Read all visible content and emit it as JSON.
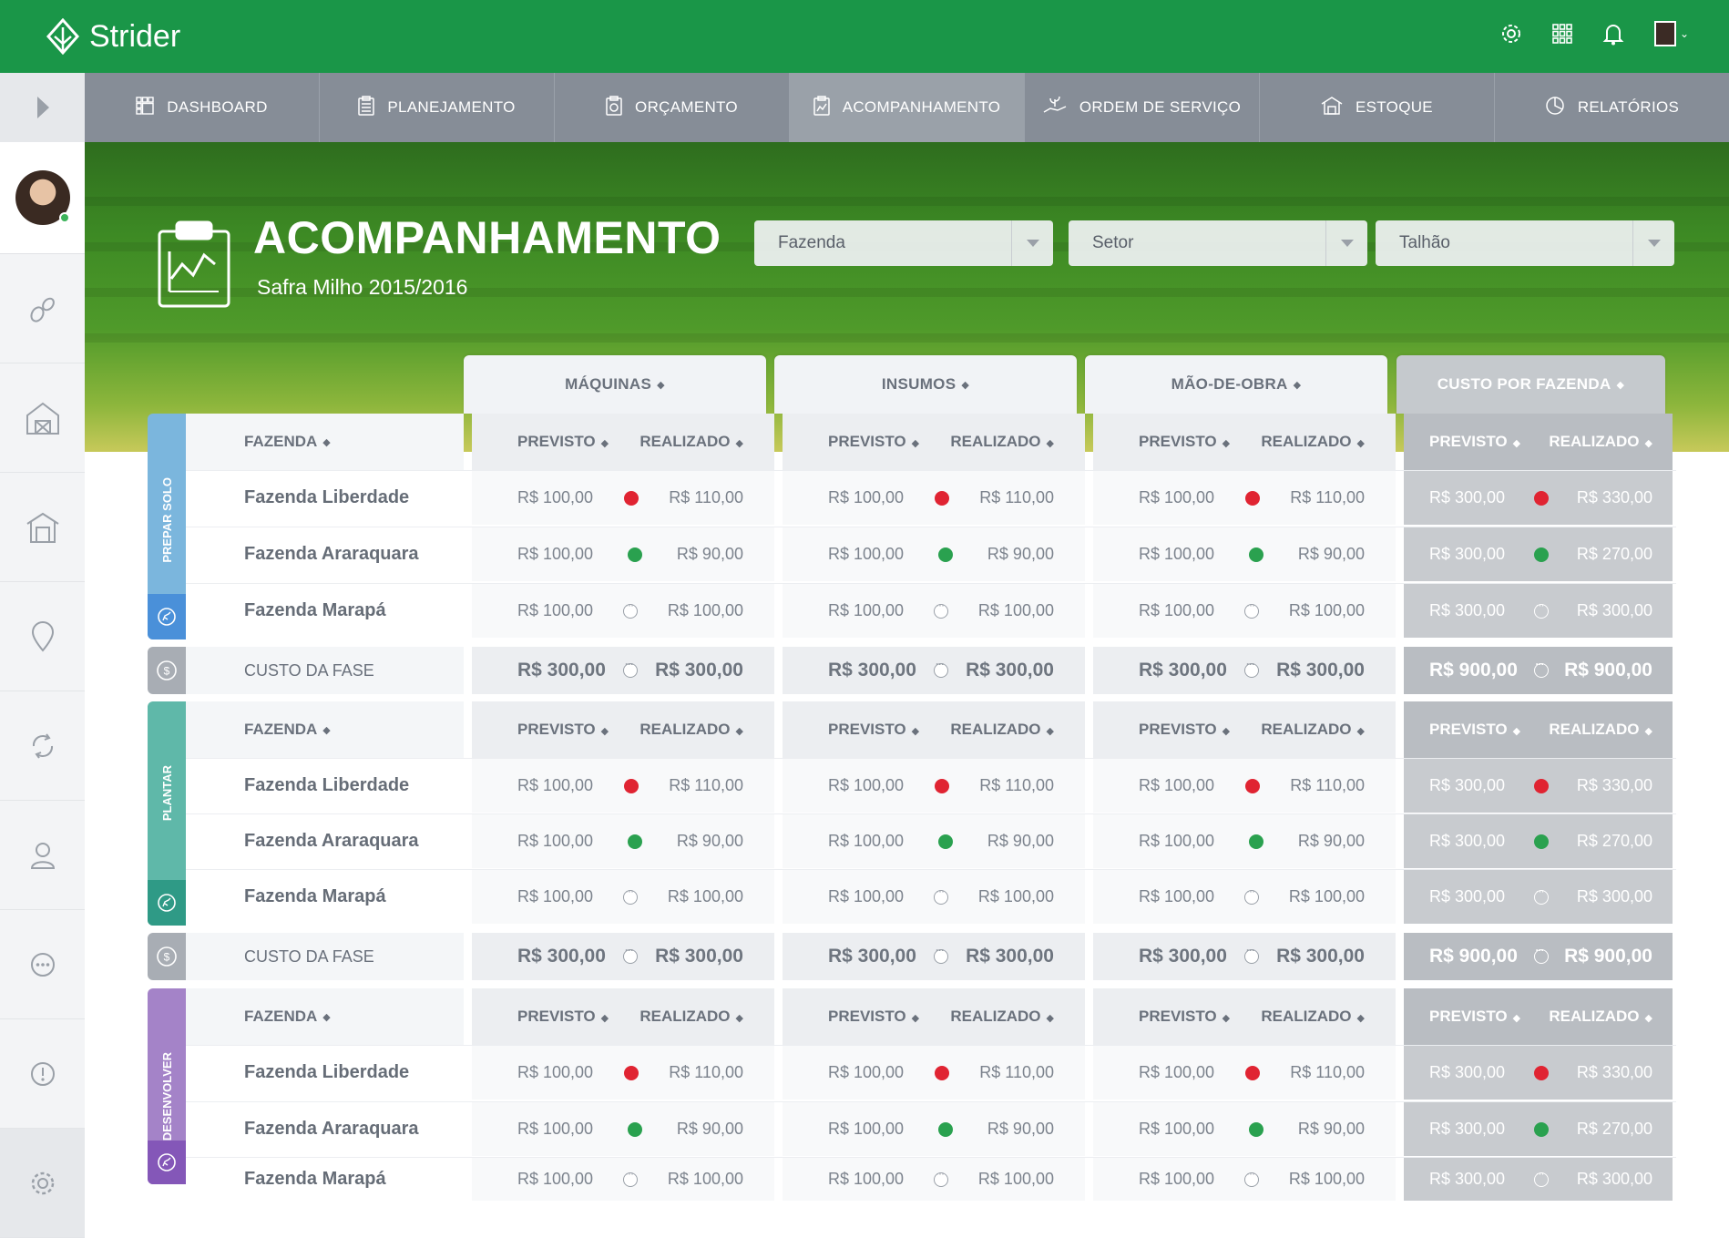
{
  "app": {
    "name": "Strider"
  },
  "nav": [
    {
      "label": "DASHBOARD",
      "icon": "dashboard-icon"
    },
    {
      "label": "PLANEJAMENTO",
      "icon": "clipboard-list-icon"
    },
    {
      "label": "ORÇAMENTO",
      "icon": "clipboard-money-icon"
    },
    {
      "label": "ACOMPANHAMENTO",
      "icon": "clipboard-chart-icon",
      "active": true
    },
    {
      "label": "ORDEM DE SERVIÇO",
      "icon": "hand-plant-icon"
    },
    {
      "label": "ESTOQUE",
      "icon": "warehouse-icon"
    },
    {
      "label": "RELATÓRIOS",
      "icon": "pie-chart-icon"
    }
  ],
  "page": {
    "title": "ACOMPANHAMENTO",
    "subtitle": "Safra Milho 2015/2016"
  },
  "filters": {
    "fazenda": "Fazenda",
    "setor": "Setor",
    "talhao": "Talhão"
  },
  "columns": {
    "maquinas": "MÁQUINAS",
    "insumos": "INSUMOS",
    "mao_de_obra": "MÃO-DE-OBRA",
    "custo_fazenda": "CUSTO POR FAZENDA"
  },
  "headers": {
    "fazenda": "FAZENDA",
    "previsto": "PREVISTO",
    "realizado": "REALIZADO",
    "custo_fase": "CUSTO DA FASE"
  },
  "phases": [
    {
      "name": "PREPAR SOLO",
      "color": "#7bb6dd",
      "icon_color": "#4a90d9"
    },
    {
      "name": "PLANTAR",
      "color": "#5fb8a9",
      "icon_color": "#2f9a86"
    },
    {
      "name": "DESENVOLVER",
      "color": "#a483c8",
      "icon_color": "#8457b8"
    }
  ],
  "farms": [
    {
      "name": "Fazenda Liberdade",
      "status": "red",
      "prev": "R$ 100,00",
      "real": "R$ 110,00",
      "tprev": "R$ 300,00",
      "treal": "R$ 330,00"
    },
    {
      "name": "Fazenda Araraquara",
      "status": "green",
      "prev": "R$ 100,00",
      "real": "R$ 90,00",
      "tprev": "R$ 300,00",
      "treal": "R$ 270,00"
    },
    {
      "name": "Fazenda Marapá",
      "status": "neutral",
      "prev": "R$ 100,00",
      "real": "R$ 100,00",
      "tprev": "R$ 300,00",
      "treal": "R$ 300,00"
    }
  ],
  "custo": {
    "prev": "R$ 300,00",
    "real": "R$ 300,00",
    "tprev": "R$ 900,00",
    "treal": "R$ 900,00"
  },
  "sidebar_icons": [
    "seeds-icon",
    "barn-icon",
    "warehouse-icon",
    "location-pin-icon",
    "sync-icon",
    "user-icon",
    "more-icon",
    "alert-icon",
    "settings-icon"
  ]
}
